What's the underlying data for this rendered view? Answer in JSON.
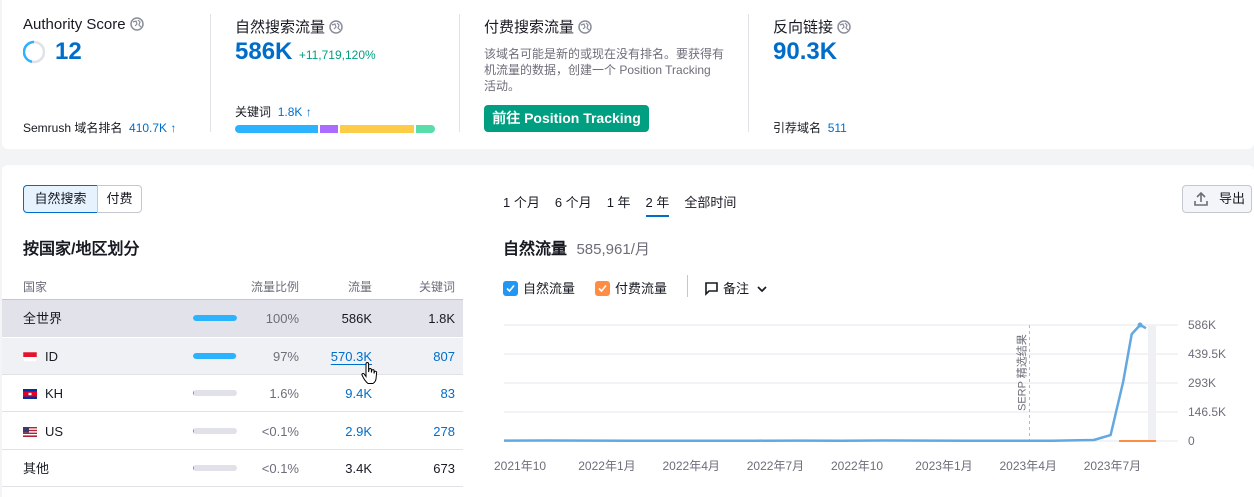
{
  "overview": {
    "authority": {
      "title": "Authority Score",
      "value": "12",
      "rank_label": "Semrush 域名排名",
      "rank_value": "410.7K",
      "rank_arrow": "↑"
    },
    "organic": {
      "title": "自然搜索流量",
      "value": "586K",
      "change": "+11,719,120%",
      "keywords_label": "关键词",
      "keywords_value": "1.8K",
      "keywords_arrow": "↑",
      "distribution": [
        {
          "share": 0.43,
          "color": "#2bb3ff"
        },
        {
          "share": 0.09,
          "color": "#ab6cfe"
        },
        {
          "share": 0.38,
          "color": "#ffcc47"
        },
        {
          "share": 0.1,
          "color": "#59ddaa"
        }
      ]
    },
    "paid": {
      "title": "付费搜索流量",
      "message": "该域名可能是新的或现在没有排名。要获得有机流量的数据，创建一个 Position Tracking 活动。",
      "message_lines": [
        "该域名可能是新的或现在没有排名。要获得有",
        "机流量的数据，创建一个 Position Tracking",
        "活动。"
      ],
      "button": "前往 Position Tracking"
    },
    "backlinks": {
      "title": "反向链接",
      "value": "90.3K",
      "ref_label": "引荐域名",
      "ref_value": "511"
    }
  },
  "toggle": {
    "organic": "自然搜索",
    "paid": "付费"
  },
  "periods": [
    "1 个月",
    "6 个月",
    "1 年",
    "2 年",
    "全部时间"
  ],
  "active_period": "2 年",
  "export_label": "导出",
  "country_section": {
    "title": "按国家/地区划分",
    "headers": [
      "国家",
      "流量比例",
      "流量",
      "关键词"
    ],
    "rows": [
      {
        "code": "全世界",
        "share": "100%",
        "share_frac": 1.0,
        "traffic": "586K",
        "keywords": "1.8K",
        "linked": false
      },
      {
        "code": "ID",
        "share": "97%",
        "share_frac": 0.97,
        "traffic": "570.3K",
        "keywords": "807",
        "linked": true
      },
      {
        "code": "KH",
        "share": "1.6%",
        "share_frac": 0.016,
        "traffic": "9.4K",
        "keywords": "83",
        "linked": true
      },
      {
        "code": "US",
        "share": "<0.1%",
        "share_frac": 0.001,
        "traffic": "2.9K",
        "keywords": "278",
        "linked": true
      },
      {
        "code": "其他",
        "share": "<0.1%",
        "share_frac": 0.001,
        "traffic": "3.4K",
        "keywords": "673",
        "linked": false
      }
    ]
  },
  "chart_section": {
    "title": "自然流量",
    "value": "585,961/月",
    "legend": {
      "organic": "自然流量",
      "paid": "付费流量",
      "notes": "备注"
    },
    "colors": {
      "organic": "#64a8e0",
      "paid": "#ff8c42",
      "annotation": "#2196f3"
    }
  },
  "chart_data": {
    "type": "line",
    "x_labels": [
      "2021年10",
      "2022年1月",
      "2022年4月",
      "2022年7月",
      "2022年10",
      "2023年1月",
      "2023年4月",
      "2023年7月"
    ],
    "y_labels": [
      "586K",
      "439.5K",
      "293K",
      "146.5K",
      "0"
    ],
    "ylim": [
      0,
      586000
    ],
    "annotation": "SERP 精选结果",
    "annotation_at": "2023年4月",
    "series": [
      {
        "values": [
          [
            0,
            2000
          ],
          [
            0.5,
            2500
          ],
          [
            1,
            2000
          ],
          [
            1.5,
            1500
          ],
          [
            2,
            1500
          ],
          [
            2.5,
            1500
          ],
          [
            3,
            1500
          ],
          [
            3.5,
            2000
          ],
          [
            4,
            1500
          ],
          [
            4.5,
            2500
          ],
          [
            5,
            2000
          ],
          [
            5.5,
            1500
          ],
          [
            6,
            1500
          ],
          [
            6.5,
            1500
          ],
          [
            7,
            5000
          ],
          [
            7.2,
            30000
          ],
          [
            7.35,
            300000
          ],
          [
            7.45,
            540000
          ],
          [
            7.55,
            586000
          ],
          [
            7.62,
            570000
          ]
        ]
      }
    ]
  }
}
